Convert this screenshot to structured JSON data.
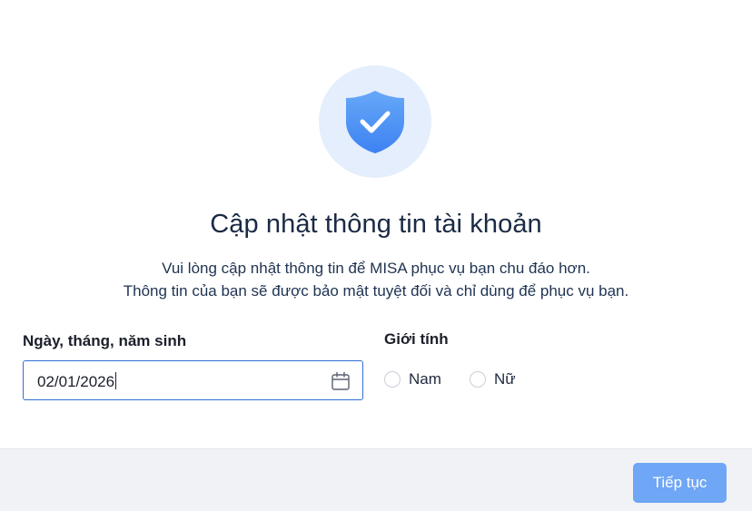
{
  "icons": {
    "hero": "shield-check-icon",
    "date_field": "calendar-icon"
  },
  "colors": {
    "accent": "#2f6fd6",
    "button_bg": "#6fa6f5",
    "shield": "#4a90f5",
    "hero_circle": "#e4eefc"
  },
  "header": {
    "title": "Cập nhật thông tin tài khoản",
    "subtitle_line1": "Vui lòng cập nhật thông tin để MISA phục vụ bạn chu đáo hơn.",
    "subtitle_line2": "Thông tin của bạn sẽ được bảo mật tuyệt đối và chỉ dùng để phục vụ bạn."
  },
  "form": {
    "dob_label": "Ngày, tháng, năm sinh",
    "dob_value": "02/01/2026",
    "gender_label": "Giới tính",
    "gender_options": [
      "Nam",
      "Nữ"
    ]
  },
  "footer": {
    "continue_label": "Tiếp tục"
  }
}
